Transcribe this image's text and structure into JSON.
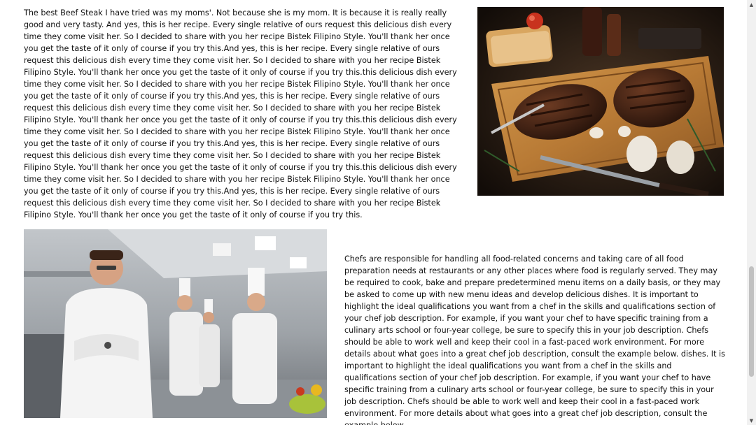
{
  "section1": {
    "text": "The best Beef Steak I have tried was my moms'. Not because she is my mom. It is because it is really really good and very tasty. And yes, this is her recipe. Every single relative of ours request this delicious dish every time they come visit her. So I decided to share with you her recipe Bistek Filipino Style. You'll thank her once you get the taste of it only of course if you try this.And yes, this is her recipe. Every single relative of ours request this delicious dish every time they come visit her. So I decided to share with you her recipe Bistek Filipino Style. You'll thank her once you get the taste of it only of course if you try this.this delicious dish every time they come visit her. So I decided to share with you her recipe Bistek Filipino Style. You'll thank her once you get the taste of it only of course if you try this.And yes, this is her recipe. Every single relative of ours request this delicious dish every time they come visit her. So I decided to share with you her recipe Bistek Filipino Style. You'll thank her once you get the taste of it only of course if you try this.this delicious dish every time they come visit her. So I decided to share with you her recipe Bistek Filipino Style. You'll thank her once you get the taste of it only of course if you try this.And yes, this is her recipe. Every single relative of ours request this delicious dish every time they come visit her. So I decided to share with you her recipe Bistek Filipino Style. You'll thank her once you get the taste of it only of course if you try this.this delicious dish every time they come visit her. So I decided to share with you her recipe Bistek Filipino Style. You'll thank her once you get the taste of it only of course if you try this.And yes, this is her recipe. Every single relative of ours request this delicious dish every time they come visit her. So I decided to share with you her recipe Bistek Filipino Style. You'll thank her once you get the taste of it only of course if you try this."
  },
  "section2": {
    "text": "Chefs are responsible for handling all food-related concerns and taking care of all food preparation needs at restaurants or any other places where food is regularly served. They may be required to cook, bake and prepare predetermined menu items on a daily basis, or they may be asked to come up with new menu ideas and develop delicious dishes. It is important to highlight the ideal qualifications you want from a chef in the skills and qualifications section of your chef job description. For example, if you want your chef to have specific training from a culinary arts school or four-year college, be sure to specify this in your job description. Chefs should be able to work well and keep their cool in a fast-paced work environment. For more details about what goes into a great chef job description, consult the example below. dishes. It is important to highlight the ideal qualifications you want from a chef in the skills and qualifications section of your chef job description. For example, if you want your chef to have specific training from a culinary arts school or four-year college, be sure to specify this in your job description. Chefs should be able to work well and keep their cool in a fast-paced work environment. For more details about what goes into a great chef job description, consult the example below."
  },
  "images": {
    "steak": "grilled-steak-on-cutting-board",
    "chefs": "chefs-in-restaurant-kitchen"
  },
  "scrollbar": {
    "up_icon": "▲",
    "down_icon": "▼"
  }
}
